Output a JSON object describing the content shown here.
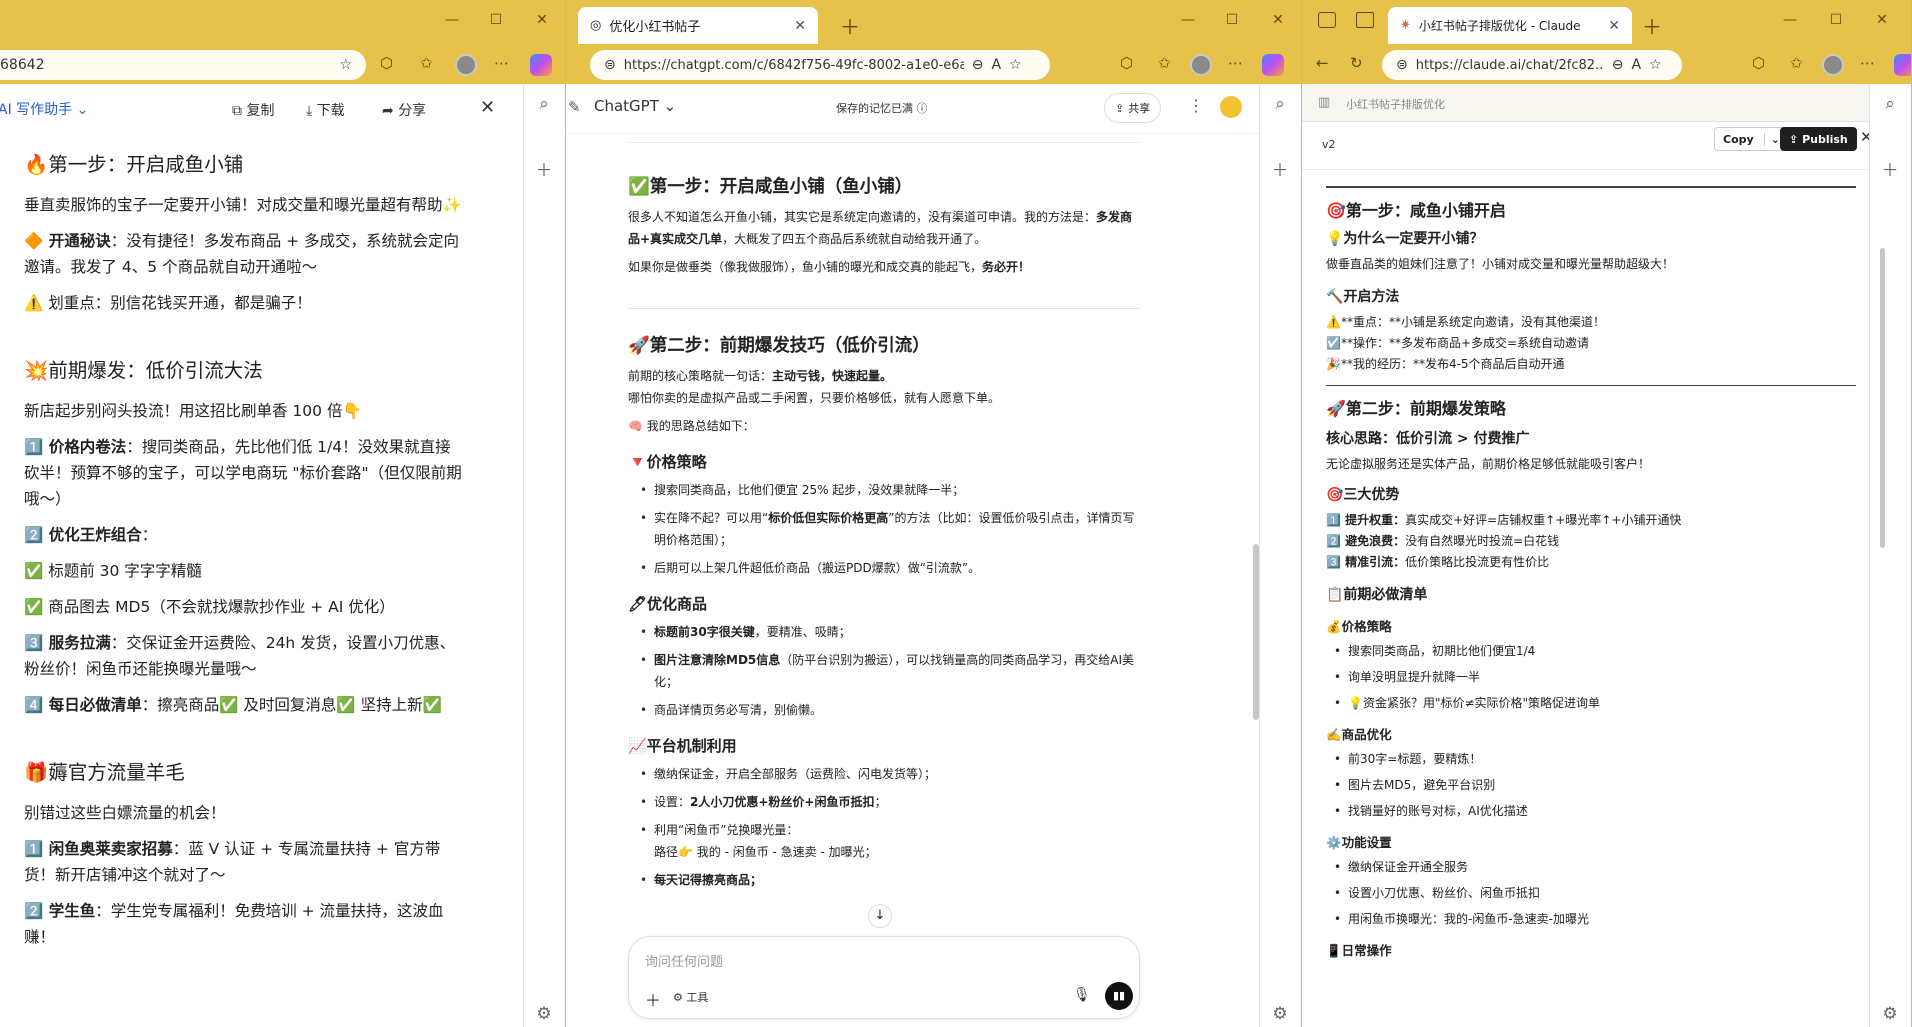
{
  "w1": {
    "url_fragment": "68642",
    "panel_title": "AI 写作助手",
    "copy": "复制",
    "download": "下载",
    "share": "分享",
    "s1_title": "🔥第一步：开启咸鱼小铺",
    "s1_p1": "垂直卖服饰的宝子一定要开小铺！对成交量和曝光量超有帮助✨",
    "s1_p2_label": "🔶 开通秘诀",
    "s1_p2_text": "：没有捷径！多发布商品 + 多成交，系统就会定向邀请。我发了 4、5 个商品就自动开通啦～",
    "s1_p3": "⚠️ 划重点：别信花钱买开通，都是骗子！",
    "s2_title": "💥前期爆发：低价引流大法",
    "s2_p1": "新店起步别闷头投流！用这招比刷单香 100 倍👇",
    "s2_i1_label": "1️⃣ 价格内卷法",
    "s2_i1_text": "：搜同类商品，先比他们低 1/4！没效果就直接砍半！预算不够的宝子，可以学电商玩 \"标价套路\"（但仅限前期哦～）",
    "s2_i2_label": "2️⃣ 优化王炸组合",
    "s2_i2_text": "：",
    "s2_i2a": "✅ 标题前 30 字字字精髓",
    "s2_i2b": "✅ 商品图去 MD5（不会就找爆款抄作业 + AI 优化）",
    "s2_i3_label": "3️⃣ 服务拉满",
    "s2_i3_text": "：交保证金开运费险、24h 发货，设置小刀优惠、粉丝价！闲鱼币还能换曝光量哦～",
    "s2_i4_label": "4️⃣ 每日必做清单",
    "s2_i4_text": "：擦亮商品✅ 及时回复消息✅ 坚持上新✅",
    "s3_title": "🎁薅官方流量羊毛",
    "s3_p1": "别错过这些白嫖流量的机会！",
    "s3_i1_label": "1️⃣ 闲鱼奥莱卖家招募",
    "s3_i1_text": "：蓝 V 认证 + 专属流量扶持 + 官方带货！新开店铺冲这个就对了～",
    "s3_i2_label": "2️⃣ 学生鱼",
    "s3_i2_text": "：学生党专属福利！免费培训 + 流量扶持，这波血赚！"
  },
  "w2": {
    "tab_title": "优化小红书帖子",
    "url": "https://chatgpt.com/c/6842f756-49fc-8002-a1e0-e6a8738a...",
    "model": "ChatGPT",
    "memory": "保存的记忆已满",
    "share": "共享",
    "s1_title": "✅第一步：开启咸鱼小铺（鱼小铺）",
    "s1_p1a": "很多人不知道怎么开鱼小铺，其实它是系统定向邀请的，没有渠道可申请。我的方法是：",
    "s1_p1b": "多发商品+真实成交几单",
    "s1_p1c": "，大概发了四五个商品后系统就自动给我开通了。",
    "s1_p2a": "如果你是做垂类（像我做服饰），鱼小铺的曝光和成交真的能起飞，",
    "s1_p2b": "务必开！",
    "s2_title": "🚀第二步：前期爆发技巧（低价引流）",
    "s2_p1a": "前期的核心策略就一句话：",
    "s2_p1b": "主动亏钱，快速起量。",
    "s2_p2": "哪怕你卖的是虚拟产品或二手闲置，只要价格够低，就有人愿意下单。",
    "s2_p3": "🧠 我的思路总结如下：",
    "h_price": "🔻价格策略",
    "price_1": "搜索同类商品，比他们便宜 25% 起步，没效果就降一半；",
    "price_2a": "实在降不起？可以用“",
    "price_2b": "标价低但实际价格更高",
    "price_2c": "”的方法（比如：设置低价吸引点击，详情页写明价格范围）；",
    "price_3": "后期可以上架几件超低价商品（搬运PDD爆款）做“引流款”。",
    "h_opt": "🖊优化商品",
    "opt_1a": "标题前30字很关键",
    "opt_1b": "，要精准、吸睛；",
    "opt_2a": "图片注意清除MD5信息",
    "opt_2b": "（防平台识别为搬运），可以找销量高的同类商品学习，再交给AI美化；",
    "opt_3": "商品详情页务必写清，别偷懒。",
    "h_plat": "📈平台机制利用",
    "plat_1": "缴纳保证金，开启全部服务（运费险、闪电发货等）；",
    "plat_2a": "设置：",
    "plat_2b": "2人小刀优惠+粉丝价+闲鱼币抵扣",
    "plat_2c": "；",
    "plat_3a": "利用“闲鱼币”兑换曝光量：",
    "plat_3b": "路径👉 我的 - 闲鱼币 - 急速卖 - 加曝光；",
    "plat_4": "每天记得擦亮商品；",
    "input_placeholder": "询问任何问题",
    "tools": "工具"
  },
  "w3": {
    "tab_title": "小红书帖子排版优化 - Claude",
    "url": "https://claude.ai/chat/2fc82...",
    "breadcrumb": "小红书帖子排版优化",
    "version": "v2",
    "copy": "Copy",
    "publish": "Publish",
    "s1_title": "🎯第一步：咸鱼小铺开启",
    "why_title": "💡为什么一定要开小铺？",
    "why_text": "做垂直品类的姐妹们注意了！小铺对成交量和曝光量帮助超级大！",
    "how_title": "🔨开启方法",
    "how_1": "⚠️**重点：**小铺是系统定向邀请，没有其他渠道！",
    "how_2": "☑️**操作：**多发布商品+多成交=系统自动邀请",
    "how_3": "🎉**我的经历：**发布4-5个商品后自动开通",
    "s2_title": "🚀第二步：前期爆发策略",
    "core": "核心思路：低价引流 > 付费推广",
    "core_text": "无论虚拟服务还是实体产品，前期价格足够低就能吸引客户！",
    "adv_title": "🎯三大优势",
    "adv_1a": "1️⃣ 提升权重：",
    "adv_1b": "真实成交+好评=店铺权重↑+曝光率↑+小铺开通快",
    "adv_2a": "2️⃣ 避免浪费：",
    "adv_2b": "没有自然曝光时投流=白花钱",
    "adv_3a": "3️⃣ 精准引流：",
    "adv_3b": "低价策略比投流更有性价比",
    "must_title": "📋前期必做清单",
    "price_title": "💰价格策略",
    "price_1": "搜索同类商品，初期比他们便宜1/4",
    "price_2": "询单没明显提升就降一半",
    "price_3": "💡资金紧张？用\"标价≠实际价格\"策略促进询单",
    "opt_title": "✍️商品优化",
    "opt_1": "前30字=标题，要精炼！",
    "opt_2": "图片去MD5，避免平台识别",
    "opt_3": "找销量好的账号对标，AI优化描述",
    "func_title": "⚙️功能设置",
    "func_1": "缴纳保证金开通全服务",
    "func_2": "设置小刀优惠、粉丝价、闲鱼币抵扣",
    "func_3": "用闲鱼币换曝光：我的-闲鱼币-急速卖-加曝光",
    "daily_title": "📱日常操作"
  }
}
